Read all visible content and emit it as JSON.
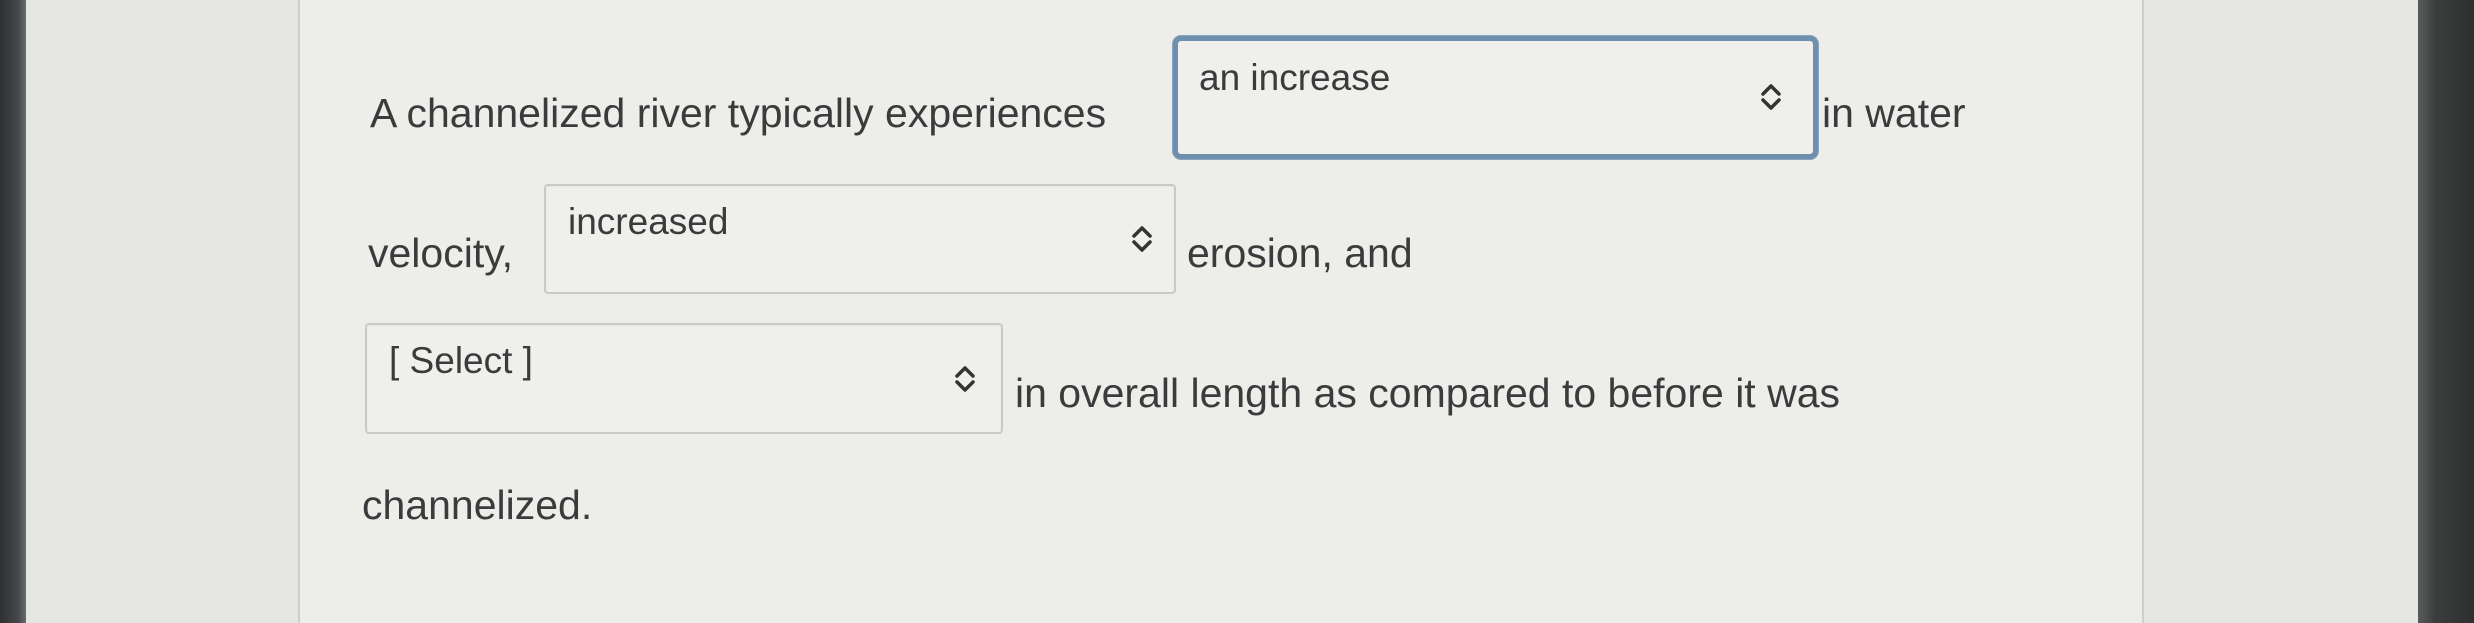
{
  "question": {
    "sentence_part_1": "A channelized river typically experiences",
    "sentence_part_2": "in water",
    "sentence_part_3": "velocity,",
    "sentence_part_4": "erosion, and",
    "sentence_part_5": "in overall length as compared to before it was",
    "sentence_part_6": "channelized."
  },
  "dropdowns": [
    {
      "selected": "an increase",
      "focused": true
    },
    {
      "selected": "increased",
      "focused": false
    },
    {
      "selected": "[ Select ]",
      "focused": false
    }
  ],
  "icons": {
    "dropdown_arrows": "chevron-up-down-icon"
  }
}
